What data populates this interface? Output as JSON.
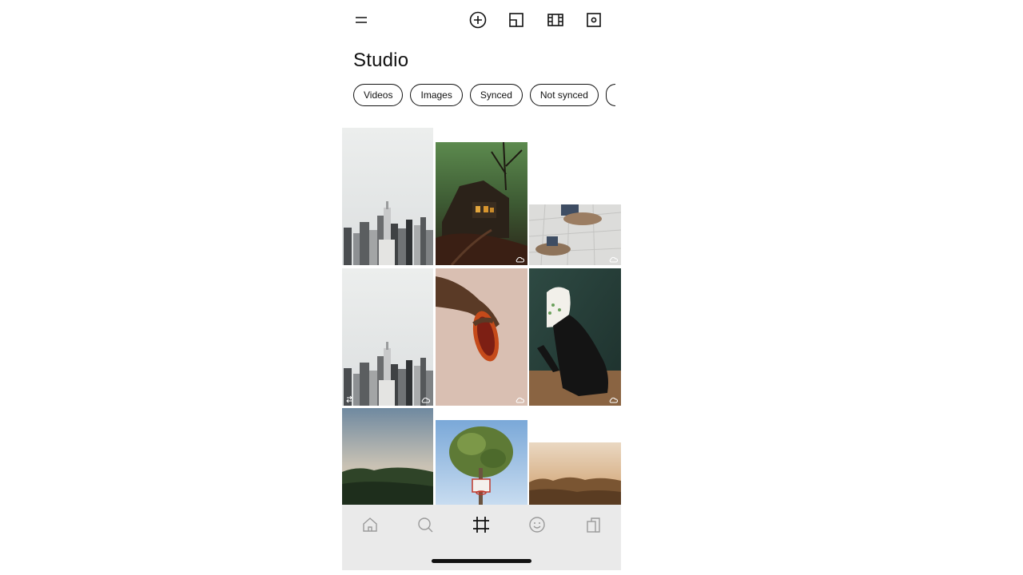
{
  "app": {
    "title": "Studio",
    "filters": [
      "Videos",
      "Images",
      "Synced",
      "Not synced"
    ]
  },
  "toolbar": {
    "icons": [
      "menu-icon",
      "add-icon",
      "layout-icon",
      "film-icon",
      "capture-icon"
    ]
  },
  "grid": {
    "tiles": [
      {
        "name": "city-skyline-photo",
        "cloud": false
      },
      {
        "name": "haunted-house-photo",
        "cloud": true
      },
      {
        "name": "shoes-on-pavement-photo",
        "cloud": true
      },
      {
        "name": "city-skyline-photo-2",
        "cloud": true
      },
      {
        "name": "hand-holding-fruit-photo",
        "cloud": true
      },
      {
        "name": "person-with-veil-photo",
        "cloud": true
      },
      {
        "name": "forest-horizon-photo",
        "cloud": false
      },
      {
        "name": "tree-basketball-hoop-photo",
        "cloud": false
      },
      {
        "name": "sunset-clouds-photo",
        "cloud": false
      }
    ]
  },
  "bottom_nav": {
    "items": [
      "home-icon",
      "search-icon",
      "frame-icon",
      "smiley-icon",
      "library-icon"
    ],
    "active": "frame-icon"
  },
  "colors": {
    "text": "#111111",
    "nav_bg": "#e8e8e8",
    "nav_inactive": "#9a9a9a"
  }
}
